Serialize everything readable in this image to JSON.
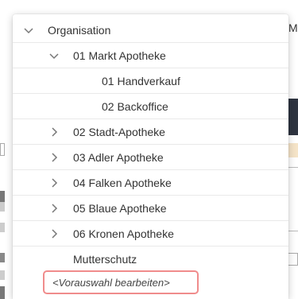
{
  "background": {
    "cutoff_header": "M"
  },
  "tree": {
    "items": [
      {
        "label": "Organisation",
        "chevron": "expanded"
      },
      {
        "label": "01 Markt Apotheke",
        "chevron": "expanded"
      },
      {
        "label": "01 Handverkauf",
        "chevron": "none"
      },
      {
        "label": "02 Backoffice",
        "chevron": "none"
      },
      {
        "label": "02 Stadt-Apotheke",
        "chevron": "collapsed"
      },
      {
        "label": "03 Adler Apotheke",
        "chevron": "collapsed"
      },
      {
        "label": "04 Falken Apotheke",
        "chevron": "collapsed"
      },
      {
        "label": "05 Blaue Apotheke",
        "chevron": "collapsed"
      },
      {
        "label": "06 Kronen Apotheke",
        "chevron": "collapsed"
      },
      {
        "label": "Mutterschutz",
        "chevron": "none"
      }
    ],
    "edit_selection_label": "<Vorauswahl bearbeiten>"
  },
  "colors": {
    "edit_border": "#f08c8c",
    "chevron": "#777777"
  }
}
